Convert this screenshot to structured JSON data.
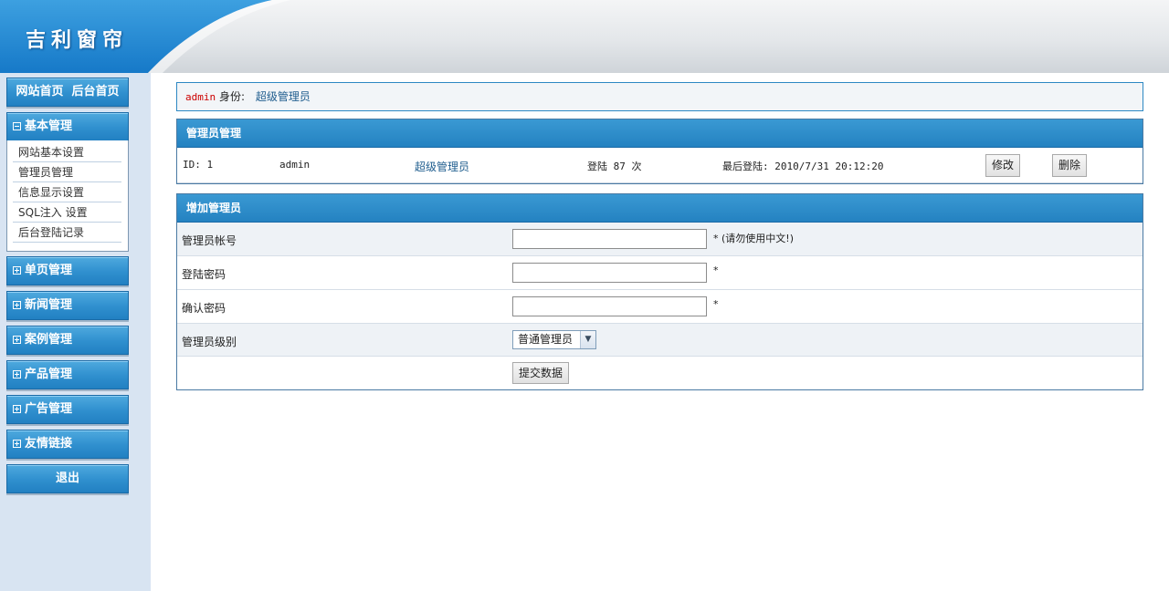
{
  "header": {
    "logo": "吉利窗帘"
  },
  "sidebar": {
    "top_links": "网站首页  后台首页",
    "sections": [
      {
        "label": "基本管理",
        "expanded": true,
        "icon": "minus-box-icon"
      },
      {
        "label": "单页管理",
        "expanded": false,
        "icon": "plus-box-icon"
      },
      {
        "label": "新闻管理",
        "expanded": false,
        "icon": "plus-box-icon"
      },
      {
        "label": "案例管理",
        "expanded": false,
        "icon": "plus-box-icon"
      },
      {
        "label": "产品管理",
        "expanded": false,
        "icon": "plus-box-icon"
      },
      {
        "label": "广告管理",
        "expanded": false,
        "icon": "plus-box-icon"
      },
      {
        "label": "友情链接",
        "expanded": false,
        "icon": "plus-box-icon"
      }
    ],
    "submenu": [
      "网站基本设置",
      "管理员管理",
      "信息显示设置",
      "SQL注入 设置",
      "后台登陆记录"
    ],
    "logout": "退出"
  },
  "info": {
    "user": "admin",
    "role_label": "身份:",
    "role": "超级管理员"
  },
  "admin_panel": {
    "title": "管理员管理",
    "row": {
      "id": "ID: 1",
      "username": "admin",
      "role": "超级管理员",
      "logins": "登陆 87 次",
      "last_login": "最后登陆: 2010/7/31 20:12:20",
      "edit": "修改",
      "delete": "删除"
    }
  },
  "add_panel": {
    "title": "增加管理员",
    "account_label": "管理员帐号",
    "account_hint": "* (请勿使用中文!)",
    "password_label": "登陆密码",
    "password_hint": "*",
    "confirm_label": "确认密码",
    "confirm_hint": "*",
    "level_label": "管理员级别",
    "level_value": "普通管理员",
    "submit": "提交数据"
  },
  "colors": {
    "accent": "#2f8fce",
    "sidebar_bg": "#d8e4f2",
    "user_red": "#cc0000",
    "link_blue": "#1f5d8e"
  }
}
